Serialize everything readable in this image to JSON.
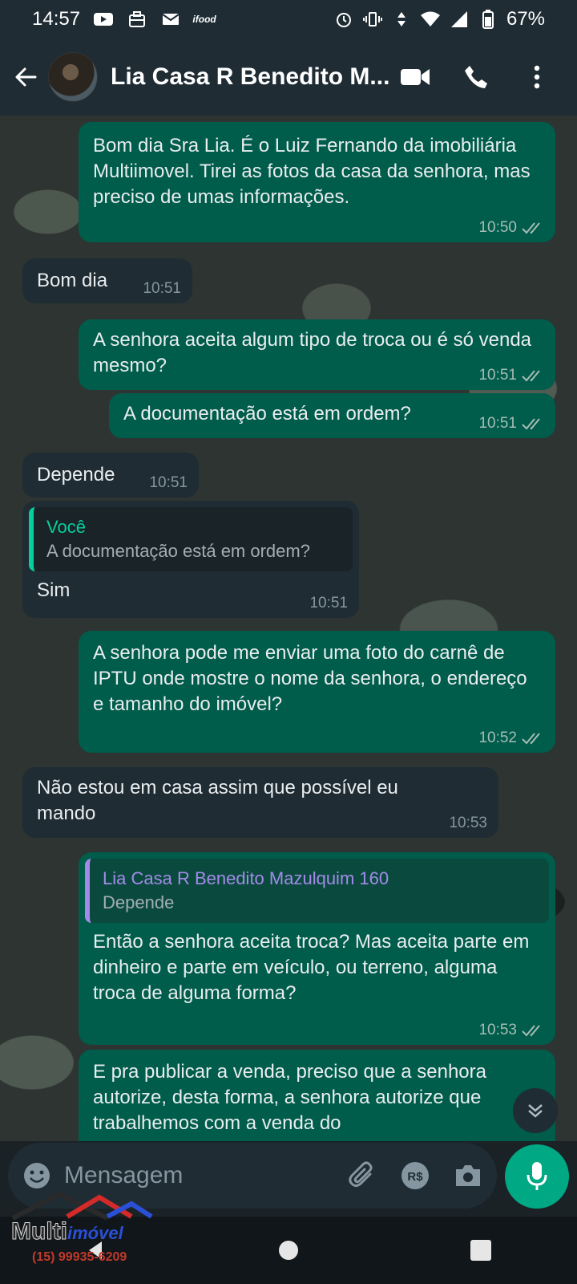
{
  "status_bar": {
    "time": "14:57",
    "battery": "67%",
    "app_icons": [
      "youtube-icon",
      "briefcase-icon",
      "mail-icon",
      "ifood-icon"
    ],
    "ifood_label": "ifood",
    "system_icons": [
      "alarm-icon",
      "vibrate-icon",
      "data-arrows-icon",
      "wifi-icon",
      "signal-icon",
      "battery-icon"
    ]
  },
  "header": {
    "contact_name": "Lia Casa R Benedito Mazulquim 160",
    "display_name": "Lia Casa R Benedito M...",
    "icons": [
      "back-arrow-icon",
      "video-call-icon",
      "phone-icon",
      "more-vert-icon"
    ]
  },
  "messages": [
    {
      "direction": "out",
      "text": "Bom dia Sra Lia. É o Luiz Fernando da imobiliária Multiimovel. Tirei as fotos da casa da senhora, mas preciso de umas informações.",
      "time": "10:50",
      "status": "read"
    },
    {
      "direction": "in",
      "text": "Bom dia",
      "time": "10:51"
    },
    {
      "direction": "out",
      "text": "A senhora aceita algum tipo de troca ou é só venda mesmo?",
      "time": "10:51",
      "status": "read"
    },
    {
      "direction": "out",
      "text": "A documentação está em ordem?",
      "time": "10:51",
      "status": "read"
    },
    {
      "direction": "in",
      "text": "Depende",
      "time": "10:51"
    },
    {
      "direction": "in",
      "text": "Sim",
      "time": "10:51",
      "quote": {
        "author": "Você",
        "text": "A documentação está em ordem?"
      }
    },
    {
      "direction": "out",
      "text": "A senhora pode me enviar uma foto do carnê de IPTU onde mostre o nome da senhora, o endereço e tamanho do imóvel?",
      "time": "10:52",
      "status": "read"
    },
    {
      "direction": "in",
      "text": "Não estou em casa assim que possível eu mando",
      "time": "10:53"
    },
    {
      "direction": "out",
      "text": "Então a senhora aceita troca? Mas aceita parte em dinheiro e parte em veículo, ou terreno, alguma troca de alguma forma?",
      "time": "10:53",
      "status": "read",
      "quote": {
        "author": "Lia Casa R Benedito Mazulquim 160",
        "text": "Depende"
      }
    },
    {
      "direction": "out",
      "text": "E pra publicar a venda, preciso que a senhora autorize, desta forma, a senhora autorize que trabalhemos com a venda do",
      "time": "",
      "status": ""
    }
  ],
  "input": {
    "placeholder": "Mensagem",
    "value": ""
  },
  "watermark": {
    "brand_part1": "Multi",
    "brand_part2": "imóvel",
    "phone": "(15) 99935-6209"
  },
  "colors": {
    "bubble_out": "#005c4b",
    "bubble_in": "#1f2c34",
    "accent": "#00a884",
    "header_bg": "#1f2c34",
    "quote_you": "#06cf9c",
    "quote_contact": "#a28be8"
  }
}
